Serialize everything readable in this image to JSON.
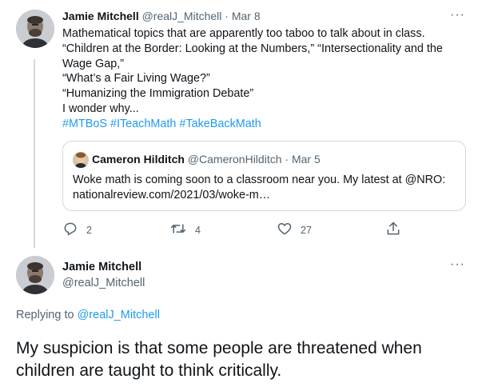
{
  "tweet1": {
    "author_name": "Jamie Mitchell",
    "handle": "@realJ_Mitchell",
    "separator": "·",
    "date": "Mar 8",
    "more_label": "···",
    "lines": [
      "Mathematical topics that are apparently too taboo to talk about in class.",
      "“Children at the Border: Looking at the Numbers,” “Intersectionality and the",
      "Wage Gap,”",
      "“What’s a Fair Living Wage?”",
      "“Humanizing the Immigration Debate”",
      "I wonder why..."
    ],
    "hashtags": [
      "#MTBoS",
      "#ITeachMath",
      "#TakeBackMath"
    ],
    "quote": {
      "author_name": "Cameron Hilditch",
      "handle": "@CameronHilditch",
      "separator": "·",
      "date": "Mar 5",
      "line1": "Woke math is coming soon to a classroom near you. My latest at @NRO:",
      "line2": "nationalreview.com/2021/03/woke-m…"
    },
    "actions": {
      "reply_icon": "reply-icon",
      "reply_count": "2",
      "retweet_icon": "retweet-icon",
      "retweet_count": "4",
      "like_icon": "heart-icon",
      "like_count": "27",
      "share_icon": "share-icon"
    }
  },
  "tweet2": {
    "author_name": "Jamie Mitchell",
    "handle": "@realJ_Mitchell",
    "more_label": "···",
    "replying_prefix": "Replying to",
    "replying_to": "@realJ_Mitchell",
    "text": "My suspicion is that some people are threatened when children are taught to think critically."
  },
  "colors": {
    "link": "#1d9bf0",
    "secondary_text": "#536471",
    "border": "#cfd9de"
  }
}
